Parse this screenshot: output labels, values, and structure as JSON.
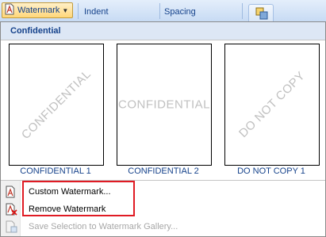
{
  "ribbon": {
    "watermark_label": "Watermark",
    "indent_label": "Indent",
    "spacing_label": "Spacing"
  },
  "menu": {
    "header": "Confidential",
    "gallery": [
      {
        "caption": "CONFIDENTIAL 1",
        "watermark": "CONFIDENTIAL",
        "style": "diagonal"
      },
      {
        "caption": "CONFIDENTIAL 2",
        "watermark": "CONFIDENTIAL",
        "style": "horizontal"
      },
      {
        "caption": "DO NOT COPY 1",
        "watermark": "DO NOT COPY",
        "style": "diagonal"
      }
    ],
    "items": [
      {
        "label": "Custom Watermark...",
        "icon": "custom-watermark-icon",
        "enabled": true
      },
      {
        "label": "Remove Watermark",
        "icon": "remove-watermark-icon",
        "enabled": true
      },
      {
        "label": "Save Selection to Watermark Gallery...",
        "icon": "save-selection-icon",
        "enabled": false
      }
    ]
  },
  "colors": {
    "accent_text": "#15428b",
    "highlight_box": "#e01b24",
    "watermark_text": "#c0c0c0"
  }
}
